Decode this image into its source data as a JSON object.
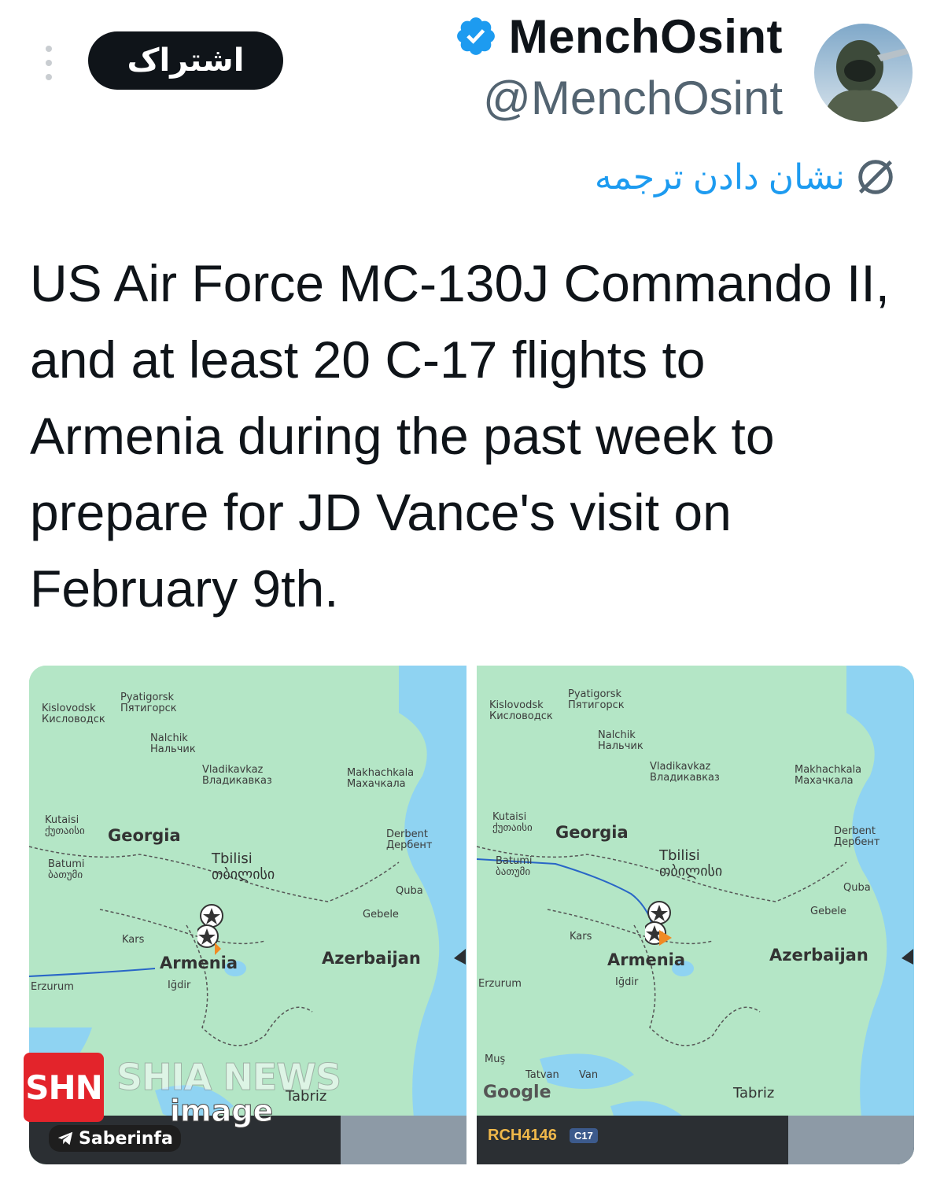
{
  "header": {
    "subscribe_label": "اشتراک",
    "display_name": "MenchOsint",
    "handle": "@MenchOsint",
    "verified_color": "#1d9bf0"
  },
  "translate": {
    "label": "نشان دادن ترجمه"
  },
  "tweet": {
    "text": "US Air Force MC-130J Commando II, and at least 20 C-17 flights to Armenia during the past week to prepare for JD Vance's visit on February 9th."
  },
  "maps": {
    "left": {
      "labels": {
        "kislovodsk": "Kislovodsk",
        "kislovodsk_ru": "Кисловодск",
        "pyatigorsk": "Pyatigorsk",
        "pyatigorsk_ru": "Пятигорск",
        "nalchik": "Nalchik",
        "nalchik_ru": "Нальчик",
        "vladikavkaz": "Vladikavkaz",
        "vladikavkaz_ru": "Владикавказ",
        "makhachkala": "Makhachkala",
        "makhachkala_ru": "Махачкала",
        "kutaisi": "Kutaisi",
        "kutaisi_ka": "ქუთაისი",
        "georgia": "Georgia",
        "derbent": "Derbent",
        "derbent_ru": "Дербент",
        "batumi": "Batumi",
        "batumi_ka": "ბათუმი",
        "tbilisi": "Tbilisi",
        "tbilisi_ka": "თბილისი",
        "quba": "Quba",
        "gebele": "Gebele",
        "kars": "Kars",
        "armenia": "Armenia",
        "azerbaijan": "Azerbaijan",
        "erzurum": "Erzurum",
        "igdir": "Iğdir",
        "tabriz": "Tabriz"
      }
    },
    "right": {
      "labels": {
        "kislovodsk": "Kislovodsk",
        "kislovodsk_ru": "Кисловодск",
        "pyatigorsk": "Pyatigorsk",
        "pyatigorsk_ru": "Пятигорск",
        "nalchik": "Nalchik",
        "nalchik_ru": "Нальчик",
        "vladikavkaz": "Vladikavkaz",
        "vladikavkaz_ru": "Владикавказ",
        "makhachkala": "Makhachkala",
        "makhachkala_ru": "Махачкала",
        "kutaisi": "Kutaisi",
        "kutaisi_ka": "ქუთაისი",
        "georgia": "Georgia",
        "derbent": "Derbent",
        "derbent_ru": "Дербент",
        "batumi": "Batumi",
        "batumi_ka": "ბათუმი",
        "tbilisi": "Tbilisi",
        "tbilisi_ka": "თბილისი",
        "quba": "Quba",
        "gebele": "Gebele",
        "kars": "Kars",
        "armenia": "Armenia",
        "azerbaijan": "Azerbaijan",
        "erzurum": "Erzurum",
        "igdir": "Iğdir",
        "mus": "Muş",
        "tatvan": "Tatvan",
        "van": "Van",
        "tabriz": "Tabriz",
        "google": "Google"
      },
      "flight": {
        "callsign": "RCH4146",
        "aircraft_type": "C17"
      }
    }
  },
  "watermarks": {
    "shn": "SHN",
    "shia_news": "SHIA NEWS",
    "image": "image",
    "saberinfa": "Saberinfa"
  }
}
